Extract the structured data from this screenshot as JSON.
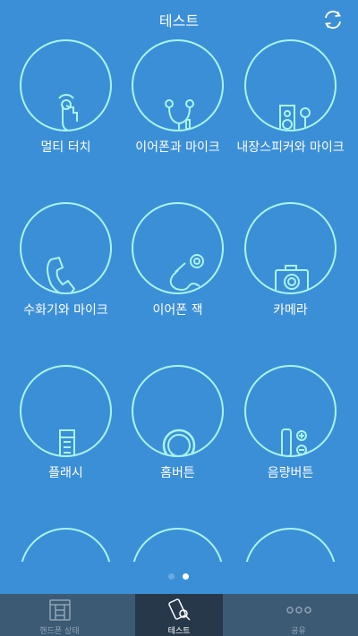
{
  "header": {
    "title": "테스트"
  },
  "items": [
    {
      "label": "멀티 터치"
    },
    {
      "label": "이어폰과 마이크"
    },
    {
      "label": "내장스피커와 마이크"
    },
    {
      "label": "수화기와 마이크"
    },
    {
      "label": "이어폰 잭"
    },
    {
      "label": "카메라"
    },
    {
      "label": "플래시"
    },
    {
      "label": "홈버튼"
    },
    {
      "label": "음량버튼"
    }
  ],
  "pager": {
    "pages": 2,
    "current": 2
  },
  "tabs": [
    {
      "label": "핸드폰 상태",
      "icon": "phone-status-icon"
    },
    {
      "label": "테스트",
      "icon": "phone-search-icon"
    },
    {
      "label": "공유",
      "icon": "share-dots-icon"
    }
  ],
  "colors": {
    "background": "#3b8fd6",
    "circle": "#a9f5ef",
    "tabbar": "#3d5a74",
    "tab_active": "#27384a"
  }
}
